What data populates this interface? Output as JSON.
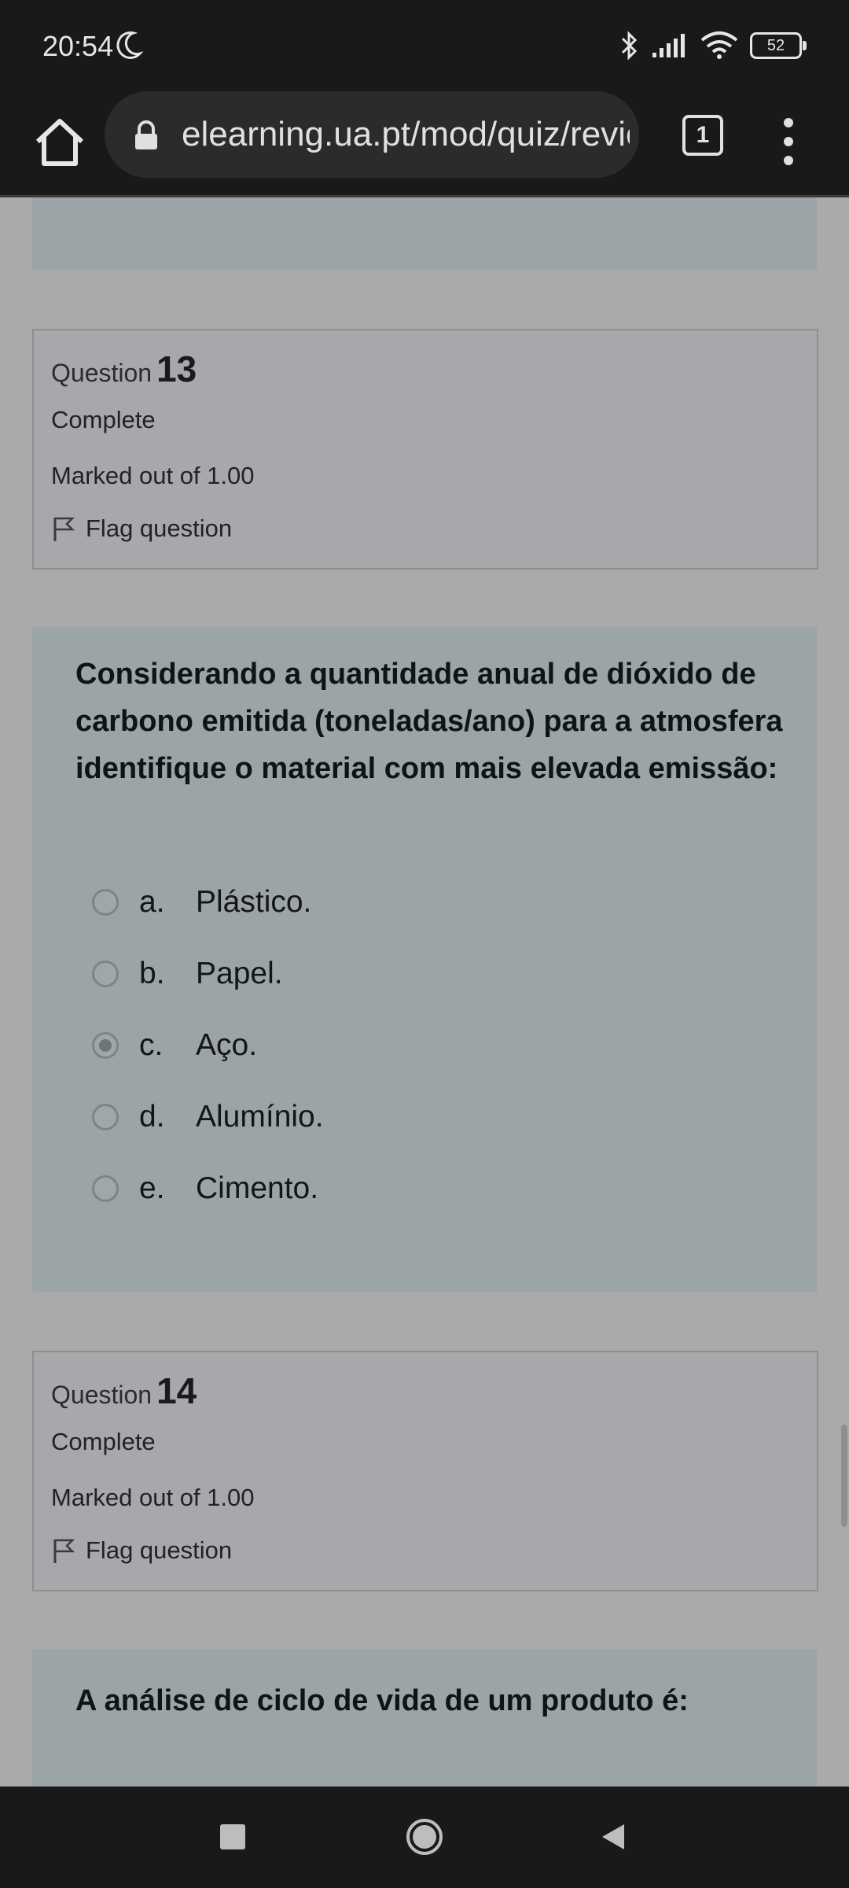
{
  "status_bar": {
    "time": "20:54",
    "battery": "52"
  },
  "browser": {
    "url": "elearning.ua.pt/mod/quiz/review",
    "tab_count": "1"
  },
  "questions": [
    {
      "label": "Question",
      "number": "13",
      "state": "Complete",
      "marks": "Marked out of 1.00",
      "flag_label": "Flag question",
      "text": "Considerando a quantidade anual de dióxido de carbono emitida (toneladas/ano) para a atmosfera identifique o material com mais elevada emissão:",
      "options": [
        {
          "letter": "a.",
          "text": "Plástico.",
          "checked": false
        },
        {
          "letter": "b.",
          "text": "Papel.",
          "checked": false
        },
        {
          "letter": "c.",
          "text": "Aço.",
          "checked": true
        },
        {
          "letter": "d.",
          "text": "Alumínio.",
          "checked": false
        },
        {
          "letter": "e.",
          "text": "Cimento.",
          "checked": false
        }
      ]
    },
    {
      "label": "Question",
      "number": "14",
      "state": "Complete",
      "marks": "Marked out of 1.00",
      "flag_label": "Flag question",
      "text": "A análise de ciclo de vida de um produto é:"
    }
  ]
}
